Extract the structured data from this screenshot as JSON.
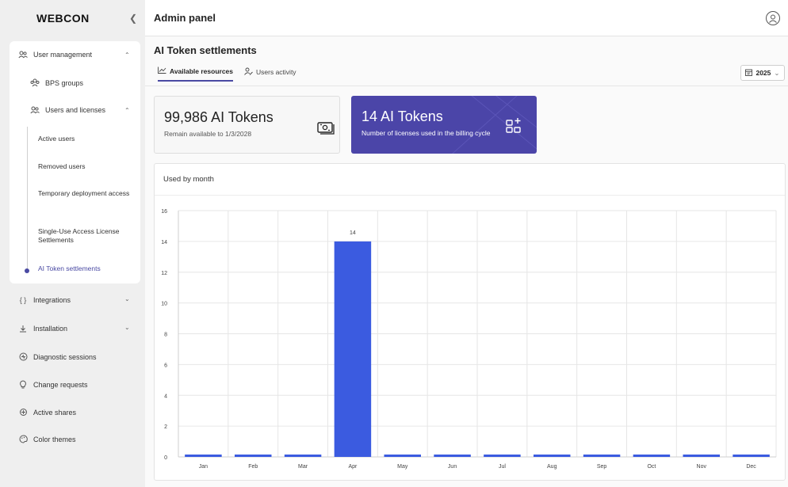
{
  "sidebar": {
    "logo": "WEBCON",
    "collapse_icon": "chevron-left-icon",
    "user_management": {
      "label": "User management",
      "icon": "people-icon"
    },
    "bps_groups": {
      "label": "BPS groups",
      "icon": "people-icon"
    },
    "users_and_licenses": {
      "label": "Users and licenses",
      "icon": "people-icon"
    },
    "sub_items": [
      {
        "label": "Active users"
      },
      {
        "label": "Removed users"
      },
      {
        "label": "Temporary deployment access"
      },
      {
        "label": "Single-Use Access License Settlements"
      },
      {
        "label": "AI Token settlements"
      }
    ],
    "items": [
      {
        "label": "Integrations",
        "icon": "braces-icon"
      },
      {
        "label": "Installation",
        "icon": "download-icon"
      },
      {
        "label": "Diagnostic sessions",
        "icon": "diagnostic-icon"
      },
      {
        "label": "Change requests",
        "icon": "lightbulb-icon"
      },
      {
        "label": "Active shares",
        "icon": "share-icon"
      },
      {
        "label": "Color themes",
        "icon": "palette-icon"
      }
    ]
  },
  "header": {
    "title": "Admin panel",
    "avatar_icon": "user-avatar-icon"
  },
  "page": {
    "title": "AI Token settlements",
    "tabs": [
      {
        "label": "Available resources",
        "icon": "chart-line-icon"
      },
      {
        "label": "Users activity",
        "icon": "user-activity-icon"
      }
    ],
    "year": "2025"
  },
  "cards": {
    "available": {
      "value": "99,986 AI Tokens",
      "caption": "Remain available to 1/3/2028",
      "icon": "money-icon"
    },
    "used": {
      "value": "14 AI Tokens",
      "caption": "Number of licenses used in the billing cycle",
      "icon": "apps-add-icon"
    }
  },
  "chart_data": {
    "type": "bar",
    "title": "Used by month",
    "categories": [
      "Jan",
      "Feb",
      "Mar",
      "Apr",
      "May",
      "Jun",
      "Jul",
      "Aug",
      "Sep",
      "Oct",
      "Nov",
      "Dec"
    ],
    "values": [
      0,
      0,
      0,
      14,
      0,
      0,
      0,
      0,
      0,
      0,
      0,
      0
    ],
    "data_labels": [
      "",
      "",
      "",
      "14",
      "",
      "",
      "",
      "",
      "",
      "",
      "",
      ""
    ],
    "ylim": [
      0,
      16
    ],
    "yticks": [
      0,
      2,
      4,
      6,
      8,
      10,
      12,
      14,
      16
    ],
    "grid": true,
    "bar_color": "#3b5be0"
  },
  "colors": {
    "accent": "#4b45a8",
    "bar": "#3b5be0"
  }
}
